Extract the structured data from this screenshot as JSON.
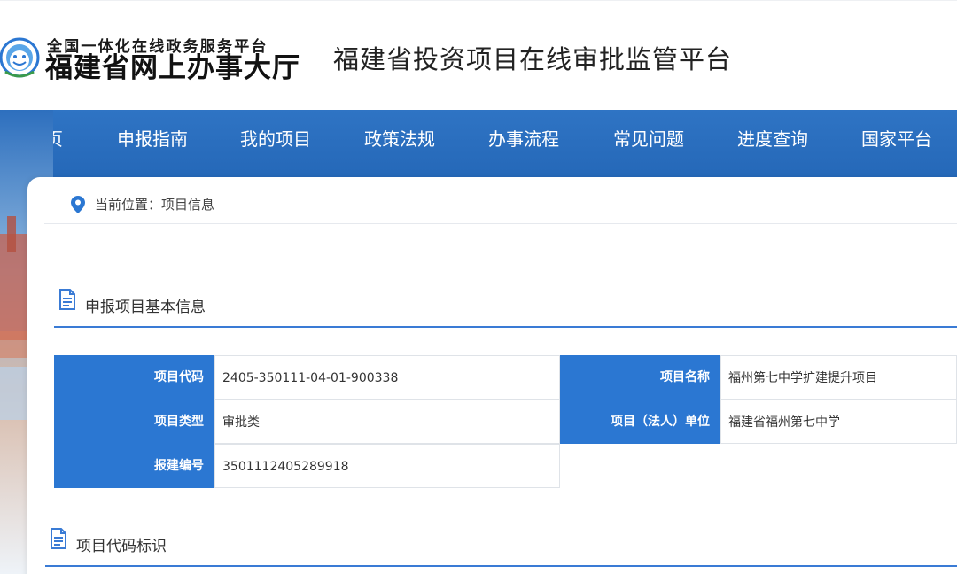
{
  "header": {
    "logo_line1": "全国一体化在线政务服务平台",
    "logo_line2": "福建省网上办事大厅",
    "platform_title": "福建省投资项目在线审批监管平台"
  },
  "nav": {
    "items": [
      "首页",
      "申报指南",
      "我的项目",
      "政策法规",
      "办事流程",
      "常见问题",
      "进度查询",
      "国家平台"
    ]
  },
  "breadcrumb": {
    "text": "当前位置：项目信息"
  },
  "sections": {
    "basic_info_title": "申报项目基本信息",
    "code_mark_title": "项目代码标识"
  },
  "project": {
    "code_label": "项目代码",
    "code_value": "2405-350111-04-01-900338",
    "name_label": "项目名称",
    "name_value": "福州第七中学扩建提升项目",
    "type_label": "项目类型",
    "type_value": "审批类",
    "unit_label": "项目（法人）单位",
    "unit_value": "福建省福州第七中学",
    "report_no_label": "报建编号",
    "report_no_value": "3501112405289918"
  },
  "colors": {
    "nav_blue": "#2f74c4",
    "label_blue": "#2b77d2",
    "rule_blue": "#3a7bd5"
  }
}
